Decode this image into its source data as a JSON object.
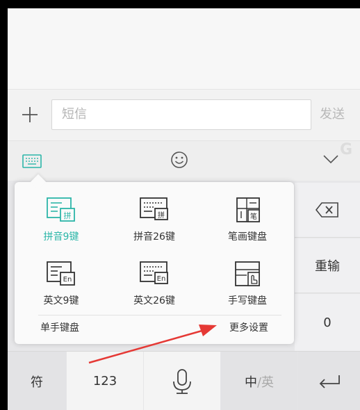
{
  "composer": {
    "placeholder": "短信",
    "send_label": "发送"
  },
  "watermark": "G",
  "side_keys": {
    "delete_icon": "backspace-icon",
    "reinput_label": "重输",
    "zero_label": "0"
  },
  "bottom_row": {
    "symbol_label": "符",
    "numbers_label": "123",
    "mic_icon": "microphone-icon",
    "lang_primary": "中",
    "lang_secondary": "/英",
    "enter_icon": "enter-icon"
  },
  "keyboard_menu": {
    "options": [
      {
        "label": "拼音9键",
        "active": true
      },
      {
        "label": "拼音26键",
        "active": false
      },
      {
        "label": "笔画键盘",
        "active": false
      },
      {
        "label": "英文9键",
        "active": false
      },
      {
        "label": "英文26键",
        "active": false
      },
      {
        "label": "手写键盘",
        "active": false
      }
    ],
    "one_hand_label": "单手键盘",
    "more_settings_label": "更多设置"
  },
  "colors": {
    "accent": "#2cb6a8",
    "arrow": "#e53935"
  }
}
